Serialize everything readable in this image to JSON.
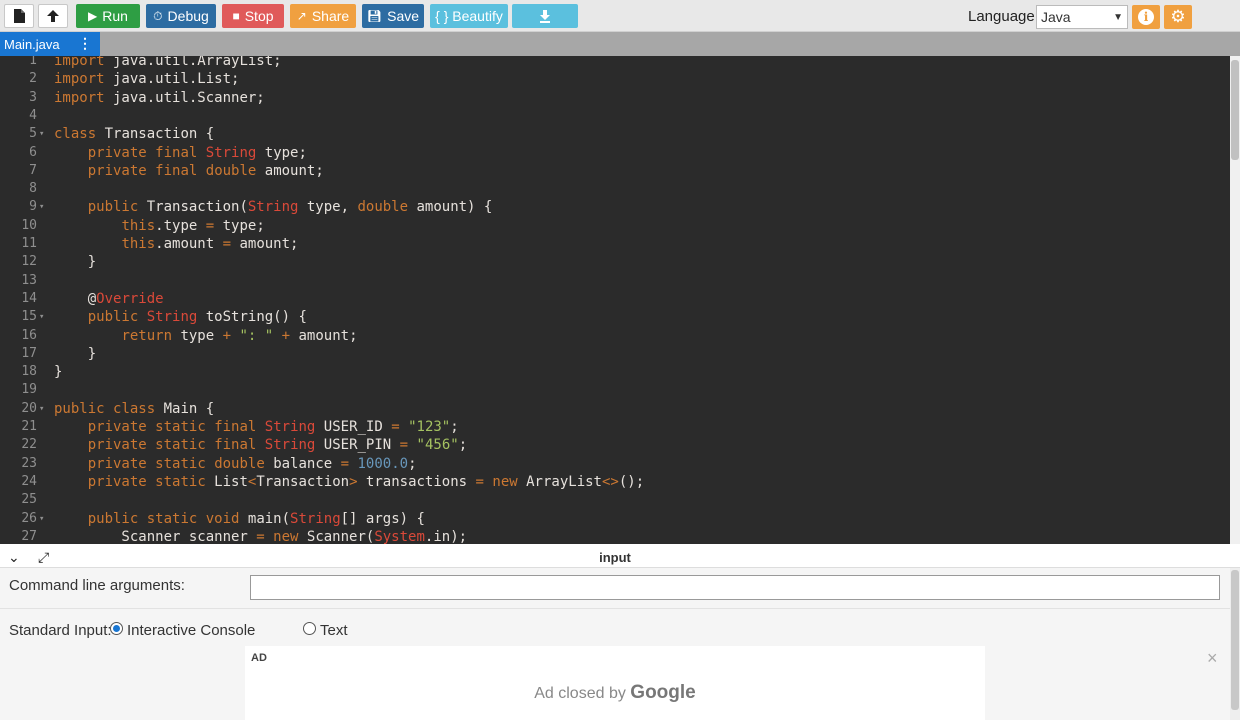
{
  "toolbar": {
    "new_icon": "file-icon",
    "upload_icon": "upload-icon",
    "run": "Run",
    "debug": "Debug",
    "stop": "Stop",
    "share": "Share",
    "save": "Save",
    "beautify": "{ } Beautify",
    "download_icon": "download-icon",
    "language_label": "Language",
    "language_value": "Java",
    "colors": {
      "run": "#2e9e44",
      "debug": "#2d6ca2",
      "stop": "#e05a5a",
      "share": "#f0a040",
      "save": "#2d6ca2",
      "beautify": "#5bc0de",
      "download": "#5bc0de"
    }
  },
  "tab": {
    "label": "Main.java"
  },
  "editor": {
    "lines": [
      {
        "n": "1",
        "fold": "",
        "html": "<span class='k'>import</span> java.util.ArrayList;"
      },
      {
        "n": "2",
        "fold": "",
        "html": "<span class='k'>import</span> java.util.List;"
      },
      {
        "n": "3",
        "fold": "",
        "html": "<span class='k'>import</span> java.util.Scanner;"
      },
      {
        "n": "4",
        "fold": "",
        "html": ""
      },
      {
        "n": "5",
        "fold": "▾",
        "html": "<span class='k'>class</span> Transaction {"
      },
      {
        "n": "6",
        "fold": "",
        "html": "    <span class='k'>private</span> <span class='k'>final</span> <span class='t'>String</span> type;"
      },
      {
        "n": "7",
        "fold": "",
        "html": "    <span class='k'>private</span> <span class='k'>final</span> <span class='k'>double</span> amount;"
      },
      {
        "n": "8",
        "fold": "",
        "html": ""
      },
      {
        "n": "9",
        "fold": "▾",
        "html": "    <span class='k'>public</span> Transaction(<span class='t'>String</span> type, <span class='k'>double</span> amount) {"
      },
      {
        "n": "10",
        "fold": "",
        "html": "        <span class='k'>this</span>.type <span class='k'>=</span> type;"
      },
      {
        "n": "11",
        "fold": "",
        "html": "        <span class='k'>this</span>.amount <span class='k'>=</span> amount;"
      },
      {
        "n": "12",
        "fold": "",
        "html": "    }"
      },
      {
        "n": "13",
        "fold": "",
        "html": ""
      },
      {
        "n": "14",
        "fold": "",
        "html": "    @<span class='a'>Override</span>"
      },
      {
        "n": "15",
        "fold": "▾",
        "html": "    <span class='k'>public</span> <span class='t'>String</span> toString() {"
      },
      {
        "n": "16",
        "fold": "",
        "html": "        <span class='k'>return</span> type <span class='k'>+</span> <span class='s'>\": \"</span> <span class='k'>+</span> amount;"
      },
      {
        "n": "17",
        "fold": "",
        "html": "    }"
      },
      {
        "n": "18",
        "fold": "",
        "html": "}"
      },
      {
        "n": "19",
        "fold": "",
        "html": ""
      },
      {
        "n": "20",
        "fold": "▾",
        "html": "<span class='k'>public</span> <span class='k'>class</span> Main {"
      },
      {
        "n": "21",
        "fold": "",
        "html": "    <span class='k'>private</span> <span class='k'>static</span> <span class='k'>final</span> <span class='t'>String</span> USER_ID <span class='k'>=</span> <span class='s'>\"123\"</span>;"
      },
      {
        "n": "22",
        "fold": "",
        "html": "    <span class='k'>private</span> <span class='k'>static</span> <span class='k'>final</span> <span class='t'>String</span> USER_PIN <span class='k'>=</span> <span class='s'>\"456\"</span>;"
      },
      {
        "n": "23",
        "fold": "",
        "html": "    <span class='k'>private</span> <span class='k'>static</span> <span class='k'>double</span> balance <span class='k'>=</span> <span class='num'>1000.0</span>;"
      },
      {
        "n": "24",
        "fold": "",
        "html": "    <span class='k'>private</span> <span class='k'>static</span> List<span class='k'>&lt;</span>Transaction<span class='k'>&gt;</span> transactions <span class='k'>=</span> <span class='k'>new</span> ArrayList<span class='k'>&lt;&gt;</span>();"
      },
      {
        "n": "25",
        "fold": "",
        "html": ""
      },
      {
        "n": "26",
        "fold": "▾",
        "html": "    <span class='k'>public</span> <span class='k'>static</span> <span class='k'>void</span> main(<span class='t'>String</span>[] args) {"
      },
      {
        "n": "27",
        "fold": "",
        "html": "        Scanner scanner <span class='k'>=</span> <span class='k'>new</span> Scanner(<span class='t'>System</span>.in);"
      }
    ]
  },
  "panel": {
    "title": "input",
    "collapse_icon": "chevron-down-icon",
    "expand_icon": "expand-icon",
    "cmd_label": "Command line arguments:",
    "cmd_value": "",
    "stdin_label": "Standard Input:",
    "opt_interactive": "Interactive Console",
    "opt_text": "Text",
    "selected": "Interactive Console"
  },
  "ad": {
    "tag": "AD",
    "closed_prefix": "Ad closed by",
    "brand": "Google",
    "close": "×"
  }
}
